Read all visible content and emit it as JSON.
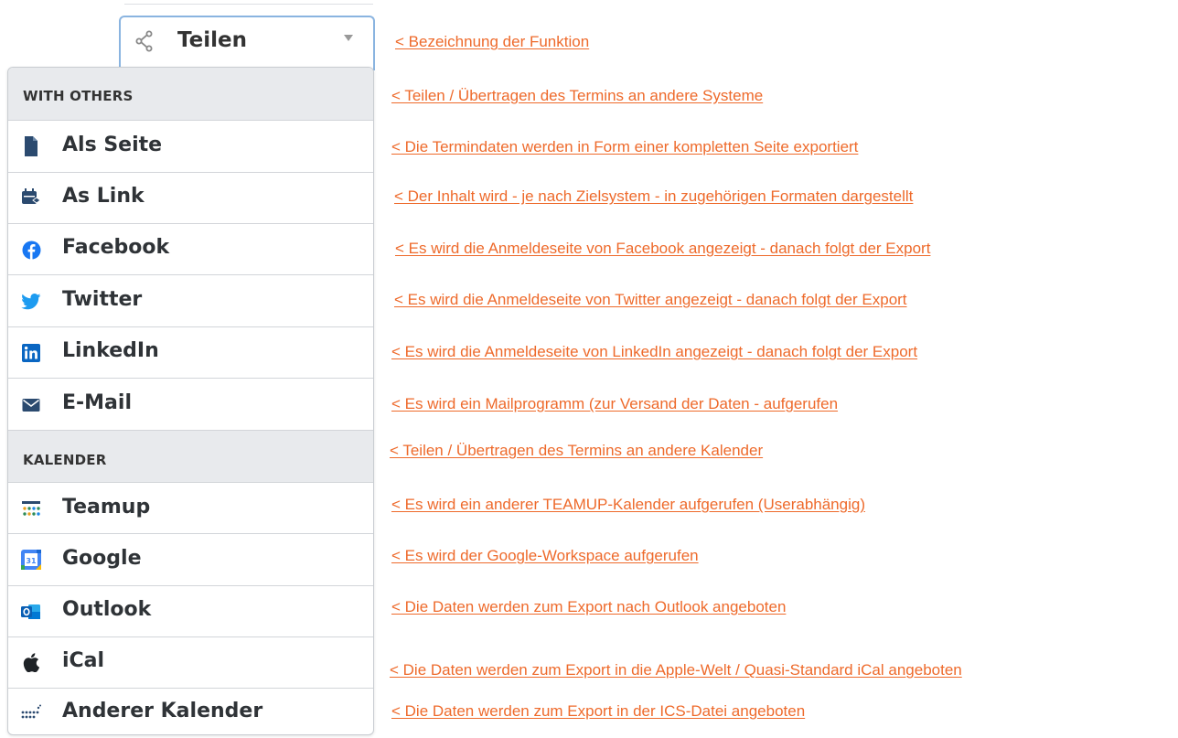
{
  "share": {
    "label": "Teilen",
    "icon": "share-icon"
  },
  "menu": {
    "sections": [
      {
        "label": "WITH OTHERS"
      },
      {
        "label": "KALENDER"
      }
    ],
    "items": [
      {
        "label": "Als Seite",
        "icon": "page-icon"
      },
      {
        "label": "As Link",
        "icon": "calendar-link-icon"
      },
      {
        "label": "Facebook",
        "icon": "facebook-icon"
      },
      {
        "label": "Twitter",
        "icon": "twitter-icon"
      },
      {
        "label": "LinkedIn",
        "icon": "linkedin-icon"
      },
      {
        "label": "E-Mail",
        "icon": "mail-icon"
      },
      {
        "label": "Teamup",
        "icon": "teamup-icon"
      },
      {
        "label": "Google",
        "icon": "google-calendar-icon"
      },
      {
        "label": "Outlook",
        "icon": "outlook-icon"
      },
      {
        "label": "iCal",
        "icon": "apple-icon"
      },
      {
        "label": "Anderer Kalender",
        "icon": "other-calendar-icon"
      }
    ]
  },
  "annotations": [
    "<  Bezeichnung der Funktion",
    "<  Teilen / Übertragen des Termins an andere Systeme",
    "<  Die Termindaten werden in Form einer kompletten Seite exportiert",
    "<  Der Inhalt wird - je nach Zielsystem - in zugehörigen Formaten dargestellt",
    "<  Es wird die Anmeldeseite von Facebook angezeigt - danach folgt der Export",
    "<  Es wird die Anmeldeseite von Twitter angezeigt - danach folgt der Export",
    "<  Es wird die Anmeldeseite von LinkedIn angezeigt - danach folgt der Export",
    "<  Es wird ein Mailprogramm (zur Versand der Daten - aufgerufen",
    "<  Teilen / Übertragen des Termins an andere Kalender",
    "<  Es wird ein anderer TEAMUP-Kalender aufgerufen (Userabhängig)",
    "<  Es wird der Google-Workspace aufgerufen",
    "<  Die Daten werden zum Export nach Outlook angeboten",
    "<  Die Daten werden zum Export in die Apple-Welt / Quasi-Standard iCal angeboten",
    "<  Die Daten werden zum Export in der ICS-Datei angeboten"
  ],
  "colors": {
    "annotation": "#ee6a2b",
    "facebook": "#1877f2",
    "twitter": "#1d9bf0",
    "linkedin": "#0a66c2",
    "focus_border": "#8ab4e0"
  }
}
